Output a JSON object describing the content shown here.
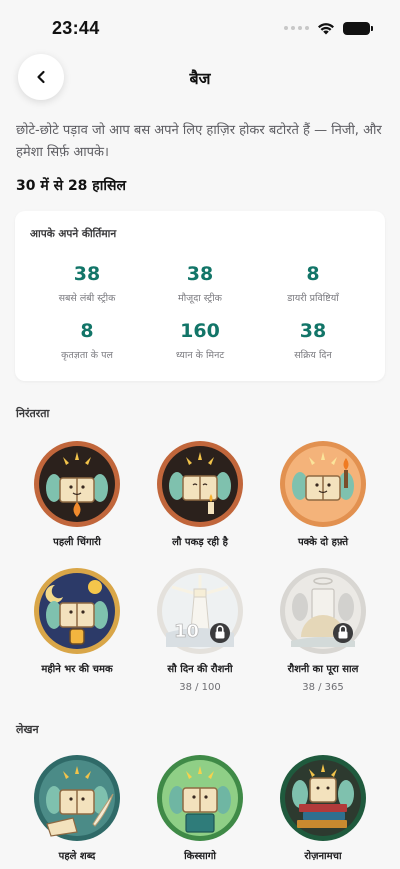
{
  "status_bar": {
    "time": "23:44"
  },
  "header": {
    "title": "बैज"
  },
  "intro": "छोटे-छोटे पड़ाव जो आप बस अपने लिए हाज़िर होकर बटोरते हैं — निजी, और हमेशा सिर्फ़ आपके।",
  "progress_text": "30 में से 28 हासिल",
  "records": {
    "title": "आपके अपने कीर्तिमान",
    "stats": [
      {
        "value": "38",
        "label": "सबसे लंबी स्ट्रीक"
      },
      {
        "value": "38",
        "label": "मौजूदा स्ट्रीक"
      },
      {
        "value": "8",
        "label": "डायरी प्रविष्टियाँ"
      },
      {
        "value": "8",
        "label": "कृतज्ञता के पल"
      },
      {
        "value": "160",
        "label": "ध्यान के मिनट"
      },
      {
        "value": "38",
        "label": "सक्रिय दिन"
      }
    ]
  },
  "sections": [
    {
      "title": "निरंतरता",
      "badges": [
        {
          "name": "पहली चिंगारी",
          "locked": false,
          "progress": ""
        },
        {
          "name": "लौ पकड़ रही है",
          "locked": false,
          "progress": ""
        },
        {
          "name": "पक्के दो हफ़्ते",
          "locked": false,
          "progress": ""
        },
        {
          "name": "महीने भर की चमक",
          "locked": false,
          "progress": ""
        },
        {
          "name": "सौ दिन की रौशनी",
          "locked": true,
          "progress": "38 / 100",
          "art_text": "10"
        },
        {
          "name": "रौशनी का पूरा साल",
          "locked": true,
          "progress": "38 / 365"
        }
      ]
    },
    {
      "title": "लेखन",
      "badges": [
        {
          "name": "पहले शब्द",
          "locked": false,
          "progress": ""
        },
        {
          "name": "किस्सागो",
          "locked": false,
          "progress": ""
        },
        {
          "name": "रोज़नामचा",
          "locked": false,
          "progress": ""
        }
      ]
    }
  ],
  "colors": {
    "accent": "#127568",
    "background": "#f7f7f7",
    "card": "#ffffff",
    "wing": "#7fc1ae"
  },
  "icons": [
    "back-chevron-icon",
    "wifi-icon",
    "battery-icon",
    "lock-icon"
  ]
}
